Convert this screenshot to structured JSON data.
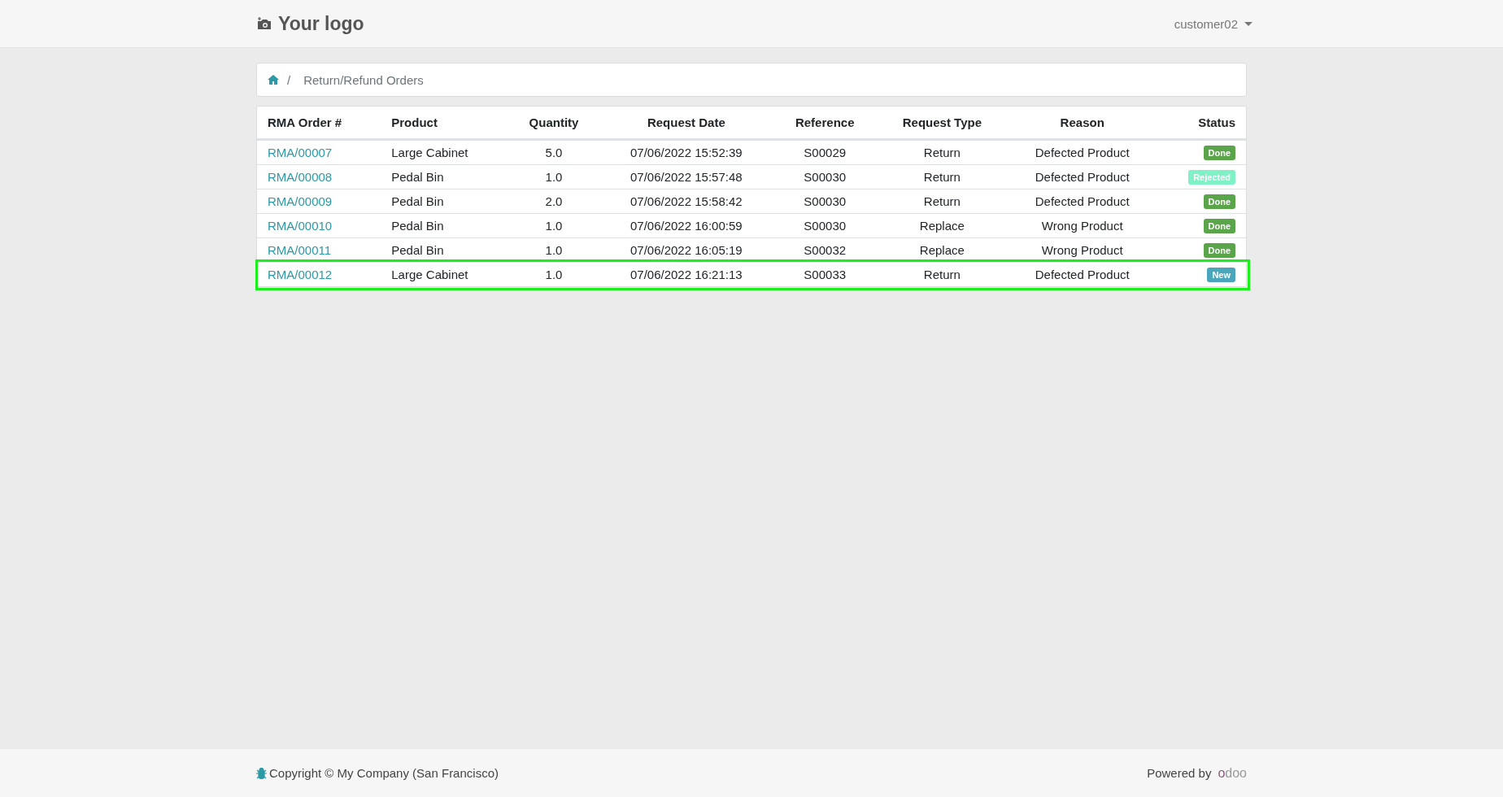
{
  "header": {
    "logo": "Your logo",
    "user": "customer02"
  },
  "breadcrumb": {
    "separator": "/",
    "current": "Return/Refund Orders"
  },
  "table": {
    "columns": [
      "RMA Order #",
      "Product",
      "Quantity",
      "Request Date",
      "Reference",
      "Request Type",
      "Reason",
      "Status"
    ],
    "rows": [
      {
        "order": "RMA/00007",
        "product": "Large Cabinet",
        "quantity": "5.0",
        "date": "07/06/2022 15:52:39",
        "reference": "S00029",
        "type": "Return",
        "reason": "Defected Product",
        "status": "Done",
        "color": "#5aa54a",
        "highlighted": false
      },
      {
        "order": "RMA/00008",
        "product": "Pedal Bin",
        "quantity": "1.0",
        "date": "07/06/2022 15:57:48",
        "reference": "S00030",
        "type": "Return",
        "reason": "Defected Product",
        "status": "Rejected",
        "color": "#7ff1c6",
        "highlighted": false
      },
      {
        "order": "RMA/00009",
        "product": "Pedal Bin",
        "quantity": "2.0",
        "date": "07/06/2022 15:58:42",
        "reference": "S00030",
        "type": "Return",
        "reason": "Defected Product",
        "status": "Done",
        "color": "#5aa54a",
        "highlighted": false
      },
      {
        "order": "RMA/00010",
        "product": "Pedal Bin",
        "quantity": "1.0",
        "date": "07/06/2022 16:00:59",
        "reference": "S00030",
        "type": "Replace",
        "reason": "Wrong Product",
        "status": "Done",
        "color": "#5aa54a",
        "highlighted": false
      },
      {
        "order": "RMA/00011",
        "product": "Pedal Bin",
        "quantity": "1.0",
        "date": "07/06/2022 16:05:19",
        "reference": "S00032",
        "type": "Replace",
        "reason": "Wrong Product",
        "status": "Done",
        "color": "#5aa54a",
        "highlighted": false
      },
      {
        "order": "RMA/00012",
        "product": "Large Cabinet",
        "quantity": "1.0",
        "date": "07/06/2022 16:21:13",
        "reference": "S00033",
        "type": "Return",
        "reason": "Defected Product",
        "status": "New",
        "color": "#4ba6bc",
        "highlighted": true
      }
    ]
  },
  "footer": {
    "copyright": "Copyright © My Company (San Francisco)",
    "powered_by": "Powered by",
    "brand": "odoo"
  }
}
